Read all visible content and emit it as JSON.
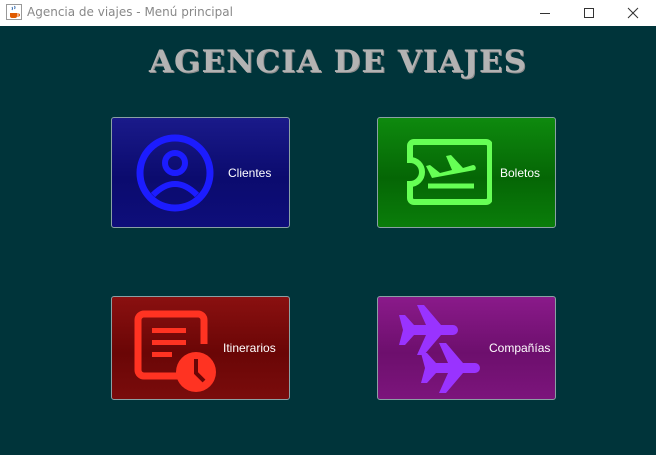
{
  "window": {
    "title": "Agencia de viajes - Menú principal",
    "app_icon": "java-coffee-icon",
    "controls": [
      "minimize-icon",
      "maximize-icon",
      "close-icon"
    ]
  },
  "main": {
    "heading": "AGENCIA DE VIAJES",
    "background_color": "#00343a",
    "tiles": [
      {
        "label": "Clientes",
        "icon": "user-circle-icon",
        "color": "#0b0b6e",
        "icon_color": "#1c1cff"
      },
      {
        "label": "Boletos",
        "icon": "flight-ticket-icon",
        "color": "#056605",
        "icon_color": "#66ff55"
      },
      {
        "label": "Itinerarios",
        "icon": "schedule-document-icon",
        "color": "#6a0606",
        "icon_color": "#ff3322"
      },
      {
        "label": "Compañías",
        "icon": "airplanes-icon",
        "color": "#6d0f6d",
        "icon_color": "#9933ff"
      }
    ]
  }
}
